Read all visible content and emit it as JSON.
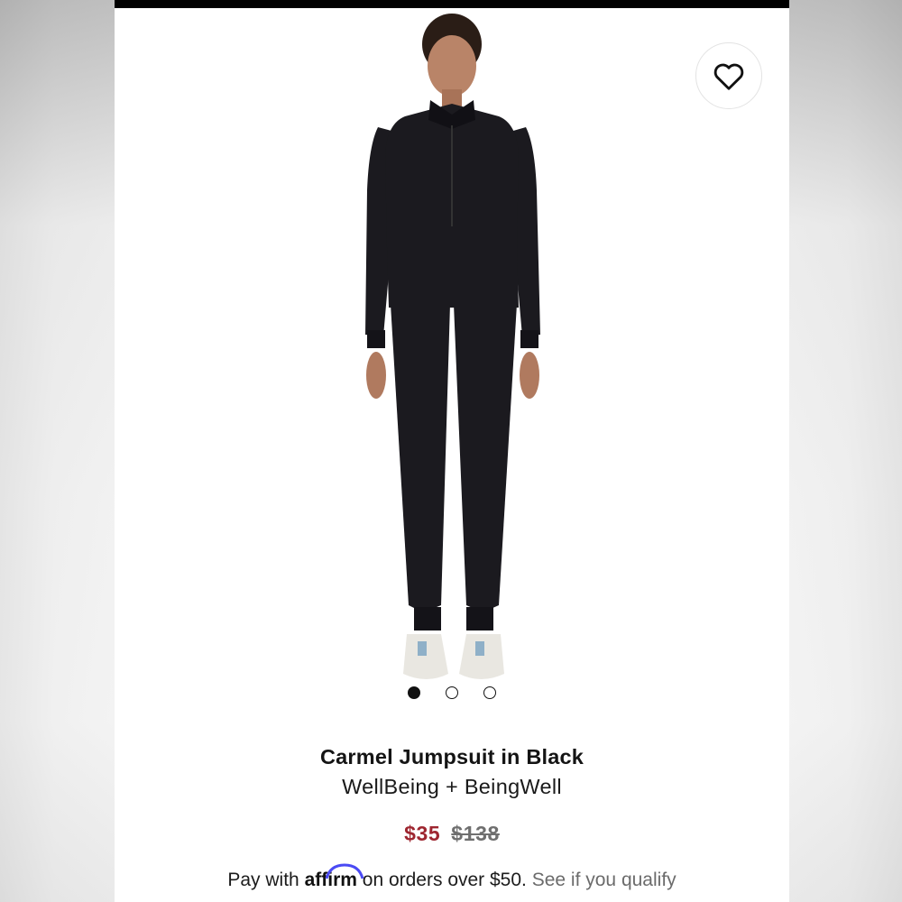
{
  "product": {
    "title": "Carmel Jumpsuit in Black",
    "brand": "WellBeing + BeingWell",
    "sale_price": "$35",
    "original_price": "$138"
  },
  "financing": {
    "prefix": "Pay with",
    "provider": "affirm",
    "suffix": "on orders over $50.",
    "link_label": "See if you qualify"
  },
  "gallery": {
    "image_count": 3,
    "active_index": 0
  },
  "icons": {
    "favorite": "heart-outline-icon"
  },
  "colors": {
    "sale_price": "#9e2630",
    "original_price": "#6f6f6f",
    "affirm_accent": "#4a4af4",
    "garment": "#1b1a1f"
  }
}
